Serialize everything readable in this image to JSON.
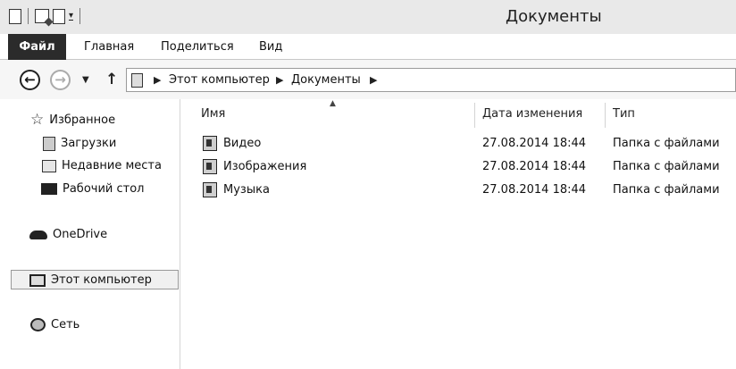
{
  "window": {
    "title": "Документы"
  },
  "ribbon": {
    "tabs": [
      {
        "label": "Файл"
      },
      {
        "label": "Главная"
      },
      {
        "label": "Поделиться"
      },
      {
        "label": "Вид"
      }
    ]
  },
  "navigation": {
    "back_icon": "←",
    "forward_icon": "→",
    "history_dropdown_icon": "▼",
    "up_icon": "↑",
    "breadcrumbs": [
      "Этот компьютер",
      "Документы"
    ],
    "separator_icon": "▶"
  },
  "sidebar": {
    "items": [
      {
        "label": "Избранное",
        "icon": "star-icon"
      },
      {
        "label": "Загрузки",
        "icon": "downloads-icon"
      },
      {
        "label": "Недавние места",
        "icon": "recent-places-icon"
      },
      {
        "label": "Рабочий стол",
        "icon": "desktop-icon"
      },
      {
        "label": "OneDrive",
        "icon": "cloud-icon"
      },
      {
        "label": "Этот компьютер",
        "icon": "computer-icon"
      },
      {
        "label": "Сеть",
        "icon": "network-icon"
      }
    ],
    "star_glyph": "☆"
  },
  "file_list": {
    "sort_indicator": "▲",
    "columns": [
      {
        "label": "Имя"
      },
      {
        "label": "Дата изменения"
      },
      {
        "label": "Тип"
      }
    ],
    "rows": [
      {
        "name": "Видео",
        "modified": "27.08.2014 18:44",
        "type": "Папка с файлами"
      },
      {
        "name": "Изображения",
        "modified": "27.08.2014 18:44",
        "type": "Папка с файлами"
      },
      {
        "name": "Музыка",
        "modified": "27.08.2014 18:44",
        "type": "Папка с файлами"
      }
    ]
  }
}
